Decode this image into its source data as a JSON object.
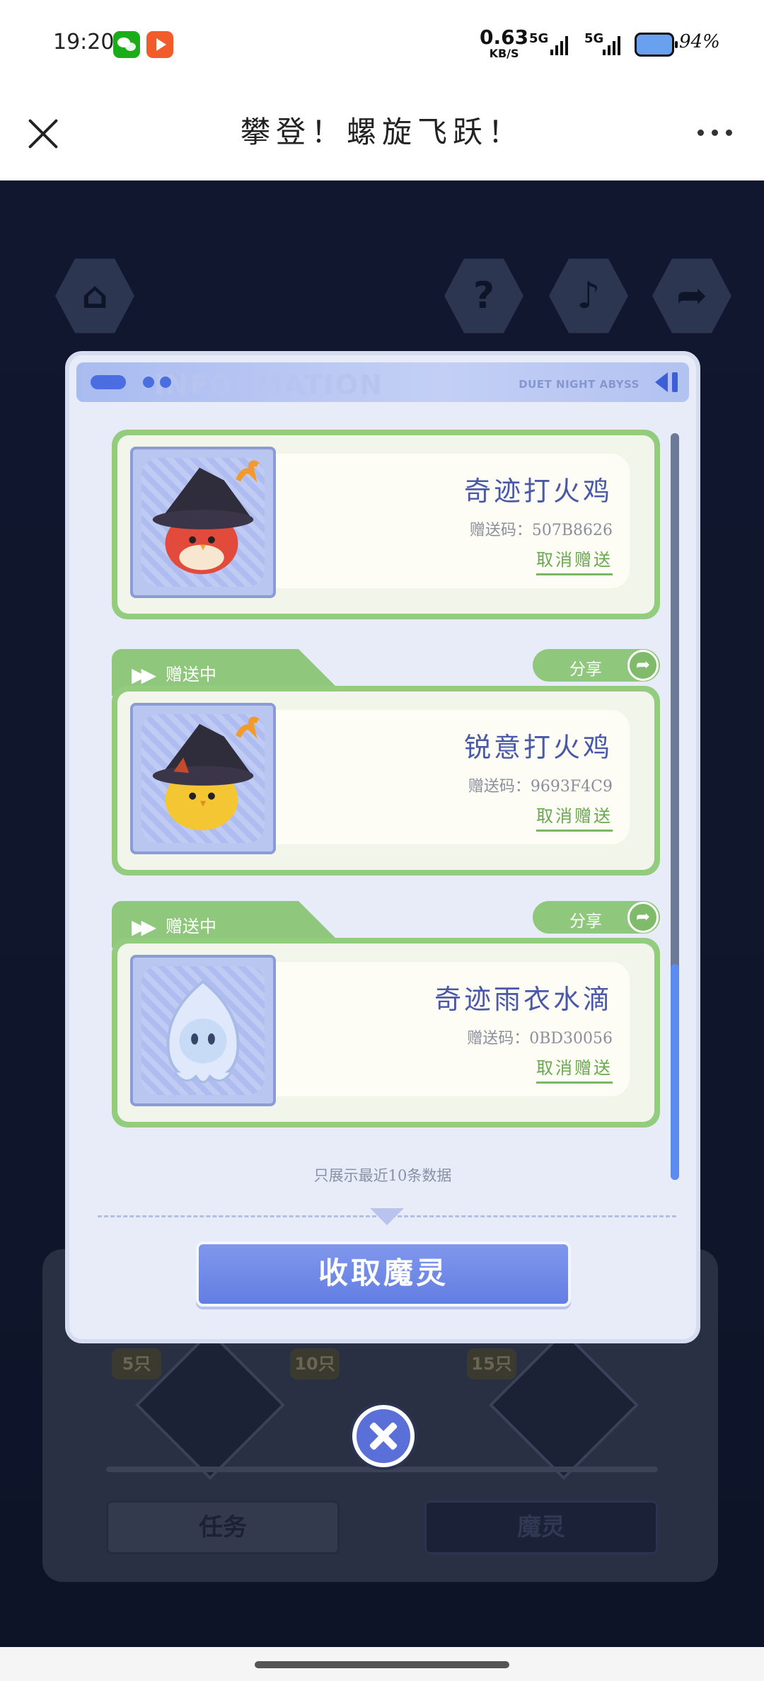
{
  "status_bar": {
    "time": "19:20",
    "net_speed": "0.63",
    "net_unit": "KB/S",
    "signal1": "5G",
    "signal2": "5G",
    "battery": "94%"
  },
  "title_bar": {
    "title": "攀登！螺旋飞跃！"
  },
  "background": {
    "hex_icons": [
      "home-icon",
      "help-icon",
      "music-icon",
      "share-icon"
    ],
    "tags": [
      "5只",
      "10只",
      "15只"
    ],
    "tabs": [
      "任务",
      "魔灵"
    ]
  },
  "modal": {
    "header_text": "DUET NIGHT ABYSS",
    "header_watermark": "INFORMATION",
    "cards": [
      {
        "status": "",
        "share_label": "",
        "pet_name": "奇迹打火鸡",
        "gift_code": "赠送码：507B8626",
        "cancel_label": "取消赠送",
        "pet_color": "#e24a3b"
      },
      {
        "status": "赠送中",
        "share_label": "分享",
        "pet_name": "锐意打火鸡",
        "gift_code": "赠送码：9693F4C9",
        "cancel_label": "取消赠送",
        "pet_color": "#f4c634"
      },
      {
        "status": "赠送中",
        "share_label": "分享",
        "pet_name": "奇迹雨衣水滴",
        "gift_code": "赠送码：0BD30056",
        "cancel_label": "取消赠送",
        "pet_color": "#dfe9fb"
      }
    ],
    "note": "只展示最近10条数据",
    "collect_label": "收取魔灵"
  }
}
